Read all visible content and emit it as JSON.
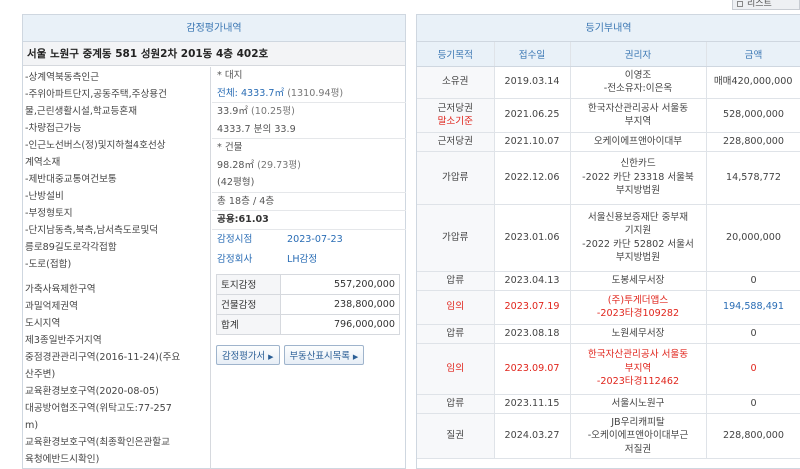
{
  "top_button": {
    "label": "리스트"
  },
  "appraisal": {
    "title": "감정평가내역",
    "address": "서울 노원구 중계동 581 성원2차 201동 4층 402호",
    "features": [
      "-상계역북동측인근",
      "-주위아파트단지,공동주택,주상용건",
      "물,근린생활시설,학교등혼재",
      "-차량접근가능",
      "-인근노선버스(정)및지하철4호선상",
      "계역소재",
      "-제반대중교통여건보통",
      "-난방설비",
      "-부정형토지",
      "-단지남동측,북측,남서측도로및덕",
      "릉로89길도로각각접함",
      "-도로(접합)"
    ],
    "zoning": [
      "가축사육제한구역",
      "과밀억제권역",
      "도시지역",
      "제3종일반주거지역",
      "중점경관관리구역(2016-11-24)(주요",
      "산주변)",
      "교육환경보호구역(2020-08-05)",
      "대공방어협조구역(위탁고도:77-257",
      "m)",
      "교육환경보호구역(최종확인은관할교",
      "육청에반드시확인)"
    ],
    "land_header": "* 대지",
    "land_total_label": "전체:",
    "land_total_value": "4333.7㎡",
    "land_total_pyeong": "(1310.94평)",
    "land_share": "33.9㎡",
    "land_share_pyeong": "(10.25평)",
    "land_ratio": "4333.7 분의 33.9",
    "building_header": "* 건물",
    "building_area": "98.28㎡",
    "building_pyeong": "(29.73평)",
    "building_pyeong2": "(42평형)",
    "floors": "총 18층 / 4층",
    "common_area": "공용:61.03",
    "appraisal_date_label": "감정시점",
    "appraisal_date": "2023-07-23",
    "appraiser_label": "감정회사",
    "appraiser": "LH감정",
    "amounts": [
      {
        "label": "토지감정",
        "value": "557,200,000"
      },
      {
        "label": "건물감정",
        "value": "238,800,000"
      },
      {
        "label": "합계",
        "value": "796,000,000"
      }
    ],
    "btn_report": "감정평가서",
    "btn_map": "부동산표시목록"
  },
  "registry": {
    "title": "등기부내역",
    "headers": [
      "등기목적",
      "접수일",
      "권리자",
      "금액"
    ],
    "rows": [
      {
        "type": "소유권",
        "date": "2019.03.14",
        "holder": [
          "이영조",
          "-전소유자:이은옥"
        ],
        "amount": "매매420,000,000",
        "red": false
      },
      {
        "type": "근저당권",
        "type2": "말소기준",
        "date": "2021.06.25",
        "holder": [
          "한국자산관리공사 서울동",
          "부지역"
        ],
        "amount": "528,000,000",
        "red": false
      },
      {
        "type": "근저당권",
        "date": "2021.10.07",
        "holder": [
          "오케이에프앤아이대부"
        ],
        "amount": "228,800,000",
        "red": false
      },
      {
        "type": "가압류",
        "date": "2022.12.06",
        "holder": [
          "신한카드",
          "-2022 카단 23318 서울북",
          "부지방법원"
        ],
        "amount": "14,578,772",
        "red": false
      },
      {
        "type": "가압류",
        "date": "2023.01.06",
        "holder": [
          "서울신용보증재단 중부재",
          "기지원",
          "-2022 카단 52802 서울서",
          "부지방법원"
        ],
        "amount": "20,000,000",
        "red": false
      },
      {
        "type": "압류",
        "date": "2023.04.13",
        "holder": [
          "도봉세무서장"
        ],
        "amount": "0",
        "red": false
      },
      {
        "type": "임의",
        "date": "2023.07.19",
        "holder": [
          "(주)투게더앱스",
          "-2023타경109282"
        ],
        "amount": "194,588,491",
        "red": true,
        "amount_blue": true
      },
      {
        "type": "압류",
        "date": "2023.08.18",
        "holder": [
          "노원세무서장"
        ],
        "amount": "0",
        "red": false
      },
      {
        "type": "임의",
        "date": "2023.09.07",
        "holder": [
          "한국자산관리공사 서울동",
          "부지역",
          "-2023타경112462"
        ],
        "amount": "0",
        "red": true
      },
      {
        "type": "압류",
        "date": "2023.11.15",
        "holder": [
          "서울시노원구"
        ],
        "amount": "0",
        "red": false
      },
      {
        "type": "질권",
        "date": "2024.03.27",
        "holder": [
          "JB우리캐피탈",
          "-오케이에프앤아이대부근",
          "저질권"
        ],
        "amount": "228,800,000",
        "red": false
      }
    ]
  },
  "colors": {
    "accent": "#3b77b3",
    "red": "#e0251c",
    "blue": "#2a6db5"
  }
}
